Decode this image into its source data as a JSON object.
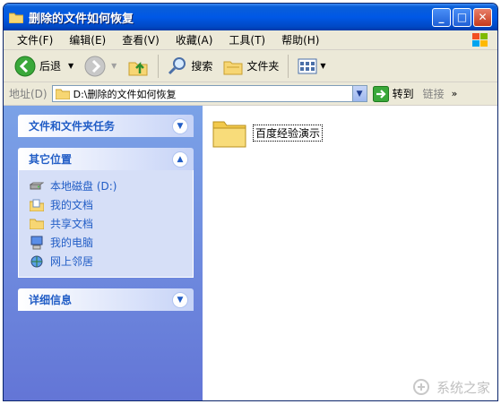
{
  "window": {
    "title": "删除的文件如何恢复"
  },
  "menu": [
    "文件(F)",
    "编辑(E)",
    "查看(V)",
    "收藏(A)",
    "工具(T)",
    "帮助(H)"
  ],
  "toolbar": {
    "back": "后退",
    "search": "搜索",
    "folders": "文件夹"
  },
  "address": {
    "label": "地址(D)",
    "path": "D:\\删除的文件如何恢复",
    "go": "转到",
    "links": "链接"
  },
  "tasks": {
    "file_tasks": "文件和文件夹任务",
    "other_places": {
      "title": "其它位置",
      "items": [
        "本地磁盘 (D:)",
        "我的文档",
        "共享文档",
        "我的电脑",
        "网上邻居"
      ]
    },
    "details": "详细信息"
  },
  "files": [
    {
      "name": "百度经验演示"
    }
  ],
  "watermark": "系统之家",
  "icons": {
    "window": "folder-icon",
    "back": "back-arrow-icon",
    "forward": "forward-arrow-icon",
    "up": "folder-up-icon",
    "search": "search-icon",
    "folders": "folders-icon",
    "views": "views-icon",
    "go": "go-arrow-icon"
  },
  "colors": {
    "titlebar": "#0058e6",
    "task_pane": "#7ba2e7",
    "task_link": "#215dc6"
  }
}
